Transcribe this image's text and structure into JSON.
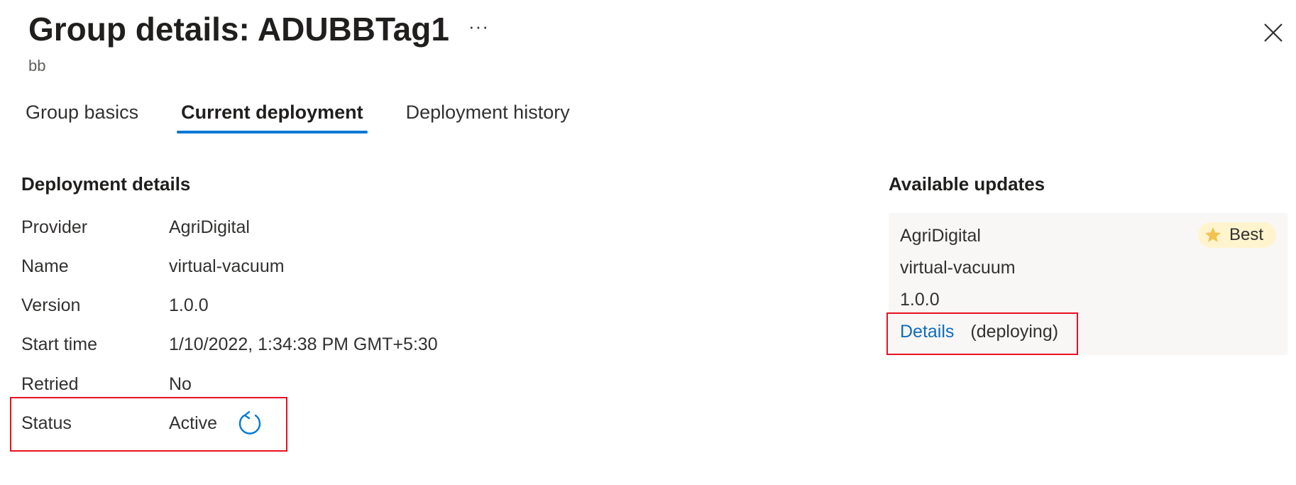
{
  "header": {
    "title": "Group details: ADUBBTag1",
    "subtitle": "bb",
    "more_label": "···"
  },
  "tabs": [
    {
      "label": "Group basics",
      "active": false
    },
    {
      "label": "Current deployment",
      "active": true
    },
    {
      "label": "Deployment history",
      "active": false
    }
  ],
  "deployment": {
    "title": "Deployment details",
    "rows": [
      {
        "label": "Provider",
        "value": "AgriDigital"
      },
      {
        "label": "Name",
        "value": "virtual-vacuum"
      },
      {
        "label": "Version",
        "value": "1.0.0"
      },
      {
        "label": "Start time",
        "value": "1/10/2022, 1:34:38 PM GMT+5:30"
      },
      {
        "label": "Retried",
        "value": "No"
      },
      {
        "label": "Status",
        "value": "Active"
      }
    ]
  },
  "updates": {
    "title": "Available updates",
    "provider": "AgriDigital",
    "name": "virtual-vacuum",
    "version": "1.0.0",
    "badge_label": "Best",
    "details_link": "Details",
    "details_status": "(deploying)"
  },
  "colors": {
    "accent": "#0078d4",
    "link": "#0f6cbd",
    "highlight_box": "#e81123",
    "badge_bg": "#fff4ce",
    "star": "#f2c14e"
  },
  "icons": [
    "more-icon",
    "close-icon",
    "refresh-icon",
    "star-icon"
  ]
}
